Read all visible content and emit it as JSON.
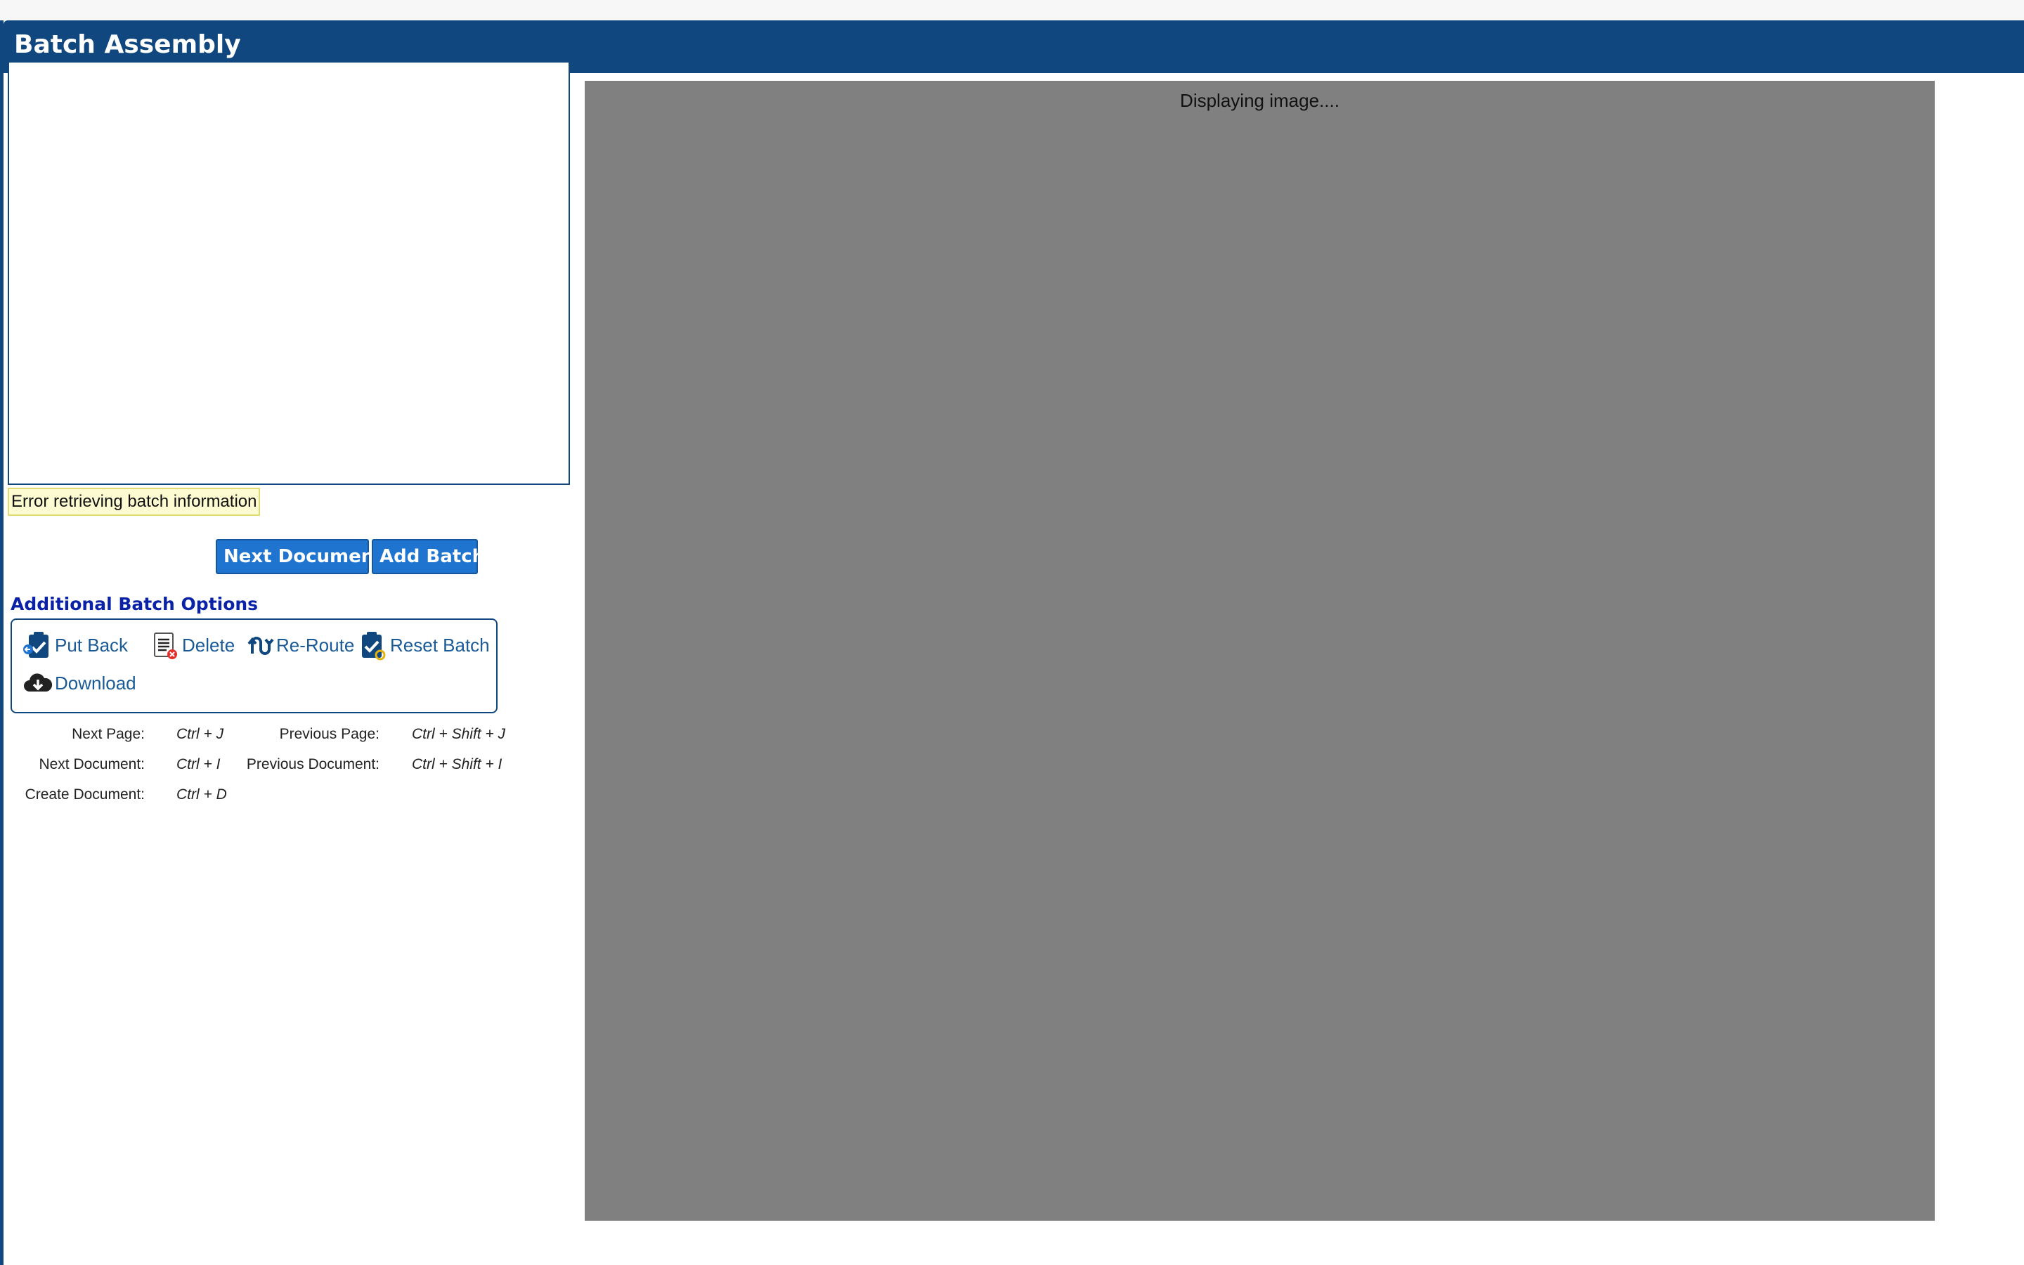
{
  "window": {
    "title": "Batch Assembly"
  },
  "batch_info": {
    "error": "Error retrieving batch information"
  },
  "buttons": {
    "next_document": "Next Document",
    "add_batch": "Add Batch"
  },
  "options": {
    "heading": "Additional Batch Options",
    "items": [
      {
        "label": "Put Back",
        "icon": "clipboard-check-back-icon"
      },
      {
        "label": "Delete",
        "icon": "document-delete-icon"
      },
      {
        "label": "Re-Route",
        "icon": "reroute-arrows-icon"
      },
      {
        "label": "Reset Batch",
        "icon": "clipboard-reset-icon"
      },
      {
        "label": "Download",
        "icon": "cloud-download-icon"
      }
    ]
  },
  "shortcuts": [
    {
      "label": "Next Page:",
      "keys": "Ctrl + J"
    },
    {
      "label": "Previous Page:",
      "keys": "Ctrl + Shift + J"
    },
    {
      "label": "Next Document:",
      "keys": "Ctrl + I"
    },
    {
      "label": "Previous Document:",
      "keys": "Ctrl + Shift + I"
    },
    {
      "label": "Create Document:",
      "keys": "Ctrl + D"
    }
  ],
  "viewer": {
    "status": "Displaying image...."
  },
  "colors": {
    "header": "#10477e",
    "button": "#1f74d0",
    "heading": "#0a22a8",
    "link": "#1a5a96",
    "viewer_bg": "#808080",
    "error_bg": "#fdfbd2"
  }
}
